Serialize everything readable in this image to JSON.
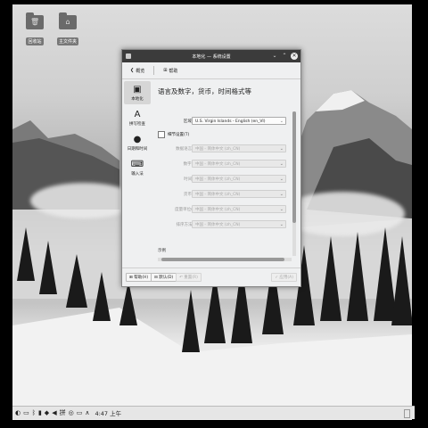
{
  "desktop": {
    "icons": [
      {
        "label": "回收站",
        "icon": "trash-folder-icon"
      },
      {
        "label": "主文件夹",
        "icon": "home-folder-icon"
      }
    ]
  },
  "window": {
    "title": "本地化 — 系统设置",
    "toolbar": {
      "overview_label": "概览",
      "help_label": "帮助"
    },
    "sidebar": [
      {
        "label": "本地化",
        "icon": "flag-icon",
        "active": true
      },
      {
        "label": "拼写检查",
        "icon": "spellcheck-icon",
        "active": false
      },
      {
        "label": "日期和时间",
        "icon": "clock-icon",
        "active": false
      },
      {
        "label": "输入法",
        "icon": "input-method-icon",
        "active": false
      }
    ],
    "heading": "语言及数字，货币，时间格式等",
    "region": {
      "label": "区域(R):",
      "value": "U.S. Virgin Islands - English (en_VI)"
    },
    "detail_checkbox": {
      "label": "细节设置(T)",
      "checked": false
    },
    "settings": [
      {
        "label": "数据语言(E):",
        "value": "中国 - 简体中文 (zh_CN)"
      },
      {
        "label": "数字(N):",
        "value": "中国 - 简体中文 (zh_CN)"
      },
      {
        "label": "时间(T):",
        "value": "中国 - 简体中文 (zh_CN)"
      },
      {
        "label": "货币(C):",
        "value": "中国 - 简体中文 (zh_CN)"
      },
      {
        "label": "度量单位(M):",
        "value": "中国 - 简体中文 (zh_CN)"
      },
      {
        "label": "排序方法(L):",
        "value": "中国 - 简体中文 (zh_CN)"
      }
    ],
    "example_label": "示例",
    "buttons": {
      "help": "帮助(H)",
      "defaults": "默认(D)",
      "reset": "重置(R)",
      "apply": "应用(A)"
    }
  },
  "taskbar": {
    "clock": "4:47 上午"
  },
  "colors": {
    "titlebar": "#3b3b3b",
    "window_bg": "#eff0f1"
  }
}
